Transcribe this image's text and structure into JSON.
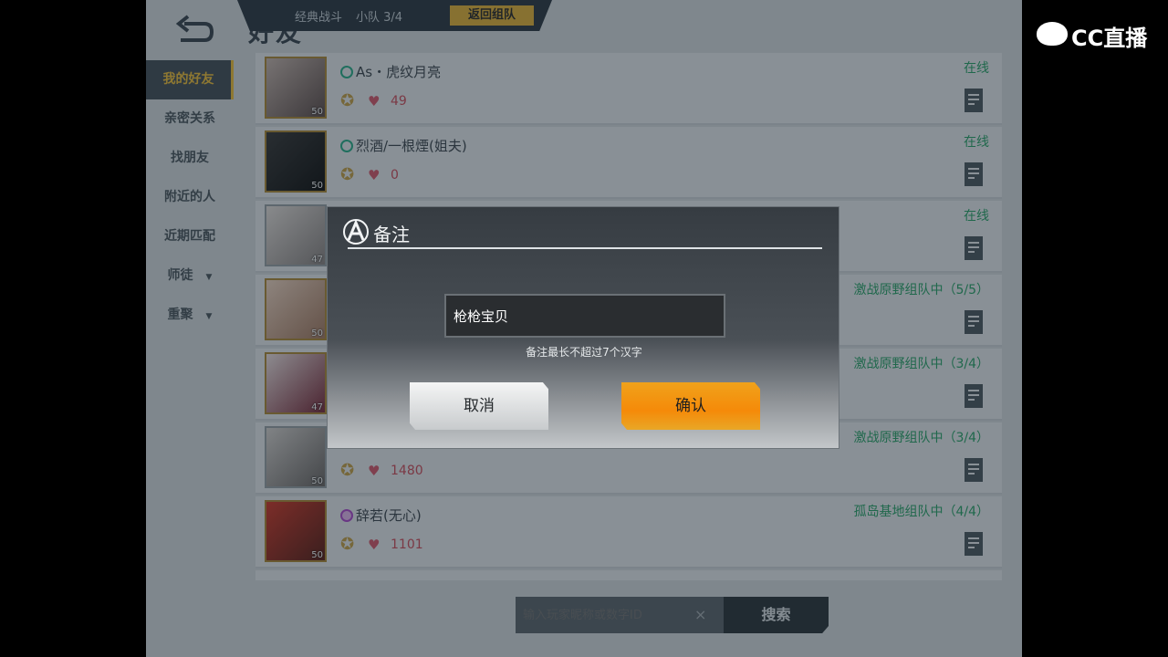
{
  "top": {
    "title": "好友",
    "team_mode": "经典战斗",
    "team_count": "小队 3/4",
    "return_button": "返回组队"
  },
  "sidebar": {
    "items": [
      {
        "label": "我的好友",
        "active": true
      },
      {
        "label": "亲密关系"
      },
      {
        "label": "找朋友"
      },
      {
        "label": "附近的人"
      },
      {
        "label": "近期匹配"
      },
      {
        "label": "师徒",
        "arrow": "▼"
      },
      {
        "label": "重聚",
        "arrow": "▼"
      }
    ]
  },
  "friends": [
    {
      "name": "As・虎纹月亮",
      "level": "50",
      "points": "49",
      "status": "在线"
    },
    {
      "name": "烈酒/一根煙(姐夫)",
      "level": "50",
      "points": "0",
      "status": "在线"
    },
    {
      "name": "",
      "level": "47",
      "points": "",
      "status": "在线"
    },
    {
      "name": "",
      "level": "50",
      "points": "",
      "status": "激战原野组队中（5/5）"
    },
    {
      "name": "",
      "level": "47",
      "points": "",
      "status": "激战原野组队中（3/4）"
    },
    {
      "name": "",
      "level": "50",
      "points": "1480",
      "status": "激战原野组队中（3/4）"
    },
    {
      "name": "辞若(无心)",
      "level": "50",
      "points": "1101",
      "status": "孤岛基地组队中（4/4）"
    }
  ],
  "search": {
    "placeholder": "输入玩家昵称或数字ID",
    "clear": "×",
    "button": "搜索"
  },
  "dialog": {
    "title": "备注",
    "input_value": "枪枪宝贝",
    "hint": "备注最长不超过7个汉字",
    "cancel": "取消",
    "confirm": "确认"
  },
  "watermark": {
    "text": "CC直播"
  },
  "colors": {
    "online": "#2aa56a",
    "accent_gold": "#f3c13b",
    "confirm_orange": "#f58a09"
  }
}
